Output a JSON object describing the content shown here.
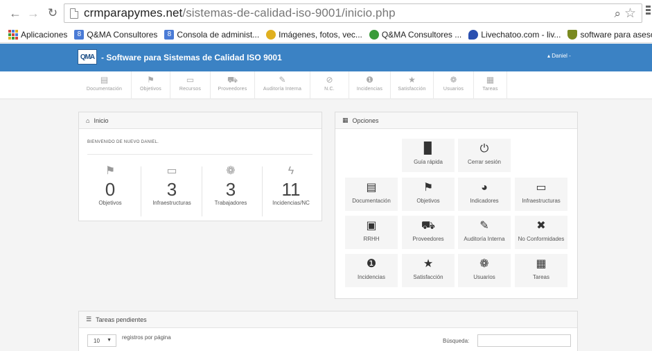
{
  "browser": {
    "url_domain": "crmparapymes.net",
    "url_path": "/sistemas-de-calidad-iso-9001/inicio.php",
    "icons": [
      "back-icon",
      "forward-icon",
      "reload-icon",
      "page-icon",
      "zoom-icon",
      "star-icon",
      "menu-icon"
    ]
  },
  "bookmarks": {
    "items": [
      {
        "label": "Aplicaciones",
        "color": "#d44638"
      },
      {
        "label": "Q&MA Consultores",
        "color": "#4a7bd6"
      },
      {
        "label": "Consola de administ...",
        "color": "#4a7bd6"
      },
      {
        "label": "Imágenes, fotos, vec...",
        "color": "#e0b020"
      },
      {
        "label": "Q&MA Consultores ...",
        "color": "#3a9b3a"
      },
      {
        "label": "Livechatoo.com - liv...",
        "color": "#2a4fb0"
      },
      {
        "label": "software para asesor...",
        "color": "#7a8a20"
      }
    ],
    "more": "»"
  },
  "header": {
    "logo": "QMA",
    "title": "- Software para Sistemas de Calidad ISO 9001",
    "user": "▴ Daniel -",
    "bg": "#3b82c4"
  },
  "nav": {
    "items": [
      {
        "label": "Documentación",
        "icon": "▤"
      },
      {
        "label": "Objetivos",
        "icon": "⚑"
      },
      {
        "label": "Recursos",
        "icon": "▭"
      },
      {
        "label": "Proveedores",
        "icon": "⛟"
      },
      {
        "label": "Auditoría Interna",
        "icon": "✎"
      },
      {
        "label": "N.C.",
        "icon": "⊘"
      },
      {
        "label": "Incidencias",
        "icon": "❶"
      },
      {
        "label": "Satisfacción",
        "icon": "★"
      },
      {
        "label": "Usuarios",
        "icon": "❁"
      },
      {
        "label": "Tareas",
        "icon": "▦"
      }
    ]
  },
  "inicio": {
    "title": "Inicio",
    "welcome": "BIENVENIDO DE NUEVO DANIEL.",
    "stats": [
      {
        "value": "0",
        "label": "Objetivos",
        "icon": "⚑"
      },
      {
        "value": "3",
        "label": "Infraestructuras",
        "icon": "▭"
      },
      {
        "value": "3",
        "label": "Trabajadores",
        "icon": "❁"
      },
      {
        "value": "11",
        "label": "Incidencias/NC",
        "icon": "ϟ"
      }
    ]
  },
  "opciones": {
    "title": "Opciones",
    "tiles": [
      {
        "label": "Guía rápida",
        "icon": "▉"
      },
      {
        "label": "Cerrar sesión",
        "icon": "⏻"
      },
      {
        "label": "Documentación",
        "icon": "▤"
      },
      {
        "label": "Objetivos",
        "icon": "⚑"
      },
      {
        "label": "Indicadores",
        "icon": "◕"
      },
      {
        "label": "Infraestructuras",
        "icon": "▭"
      },
      {
        "label": "RRHH",
        "icon": "▣"
      },
      {
        "label": "Proveedores",
        "icon": "⛟"
      },
      {
        "label": "Auditoría Interna",
        "icon": "✎"
      },
      {
        "label": "No Conformidades",
        "icon": "✖"
      },
      {
        "label": "Incidencias",
        "icon": "❶"
      },
      {
        "label": "Satisfacción",
        "icon": "★"
      },
      {
        "label": "Usuarios",
        "icon": "❁"
      },
      {
        "label": "Tareas",
        "icon": "▦"
      }
    ]
  },
  "tareas": {
    "title": "Tareas pendientes",
    "page_size": "10",
    "per_page_label": "registros por página",
    "search_label": "Búsqueda:",
    "search_value": ""
  }
}
